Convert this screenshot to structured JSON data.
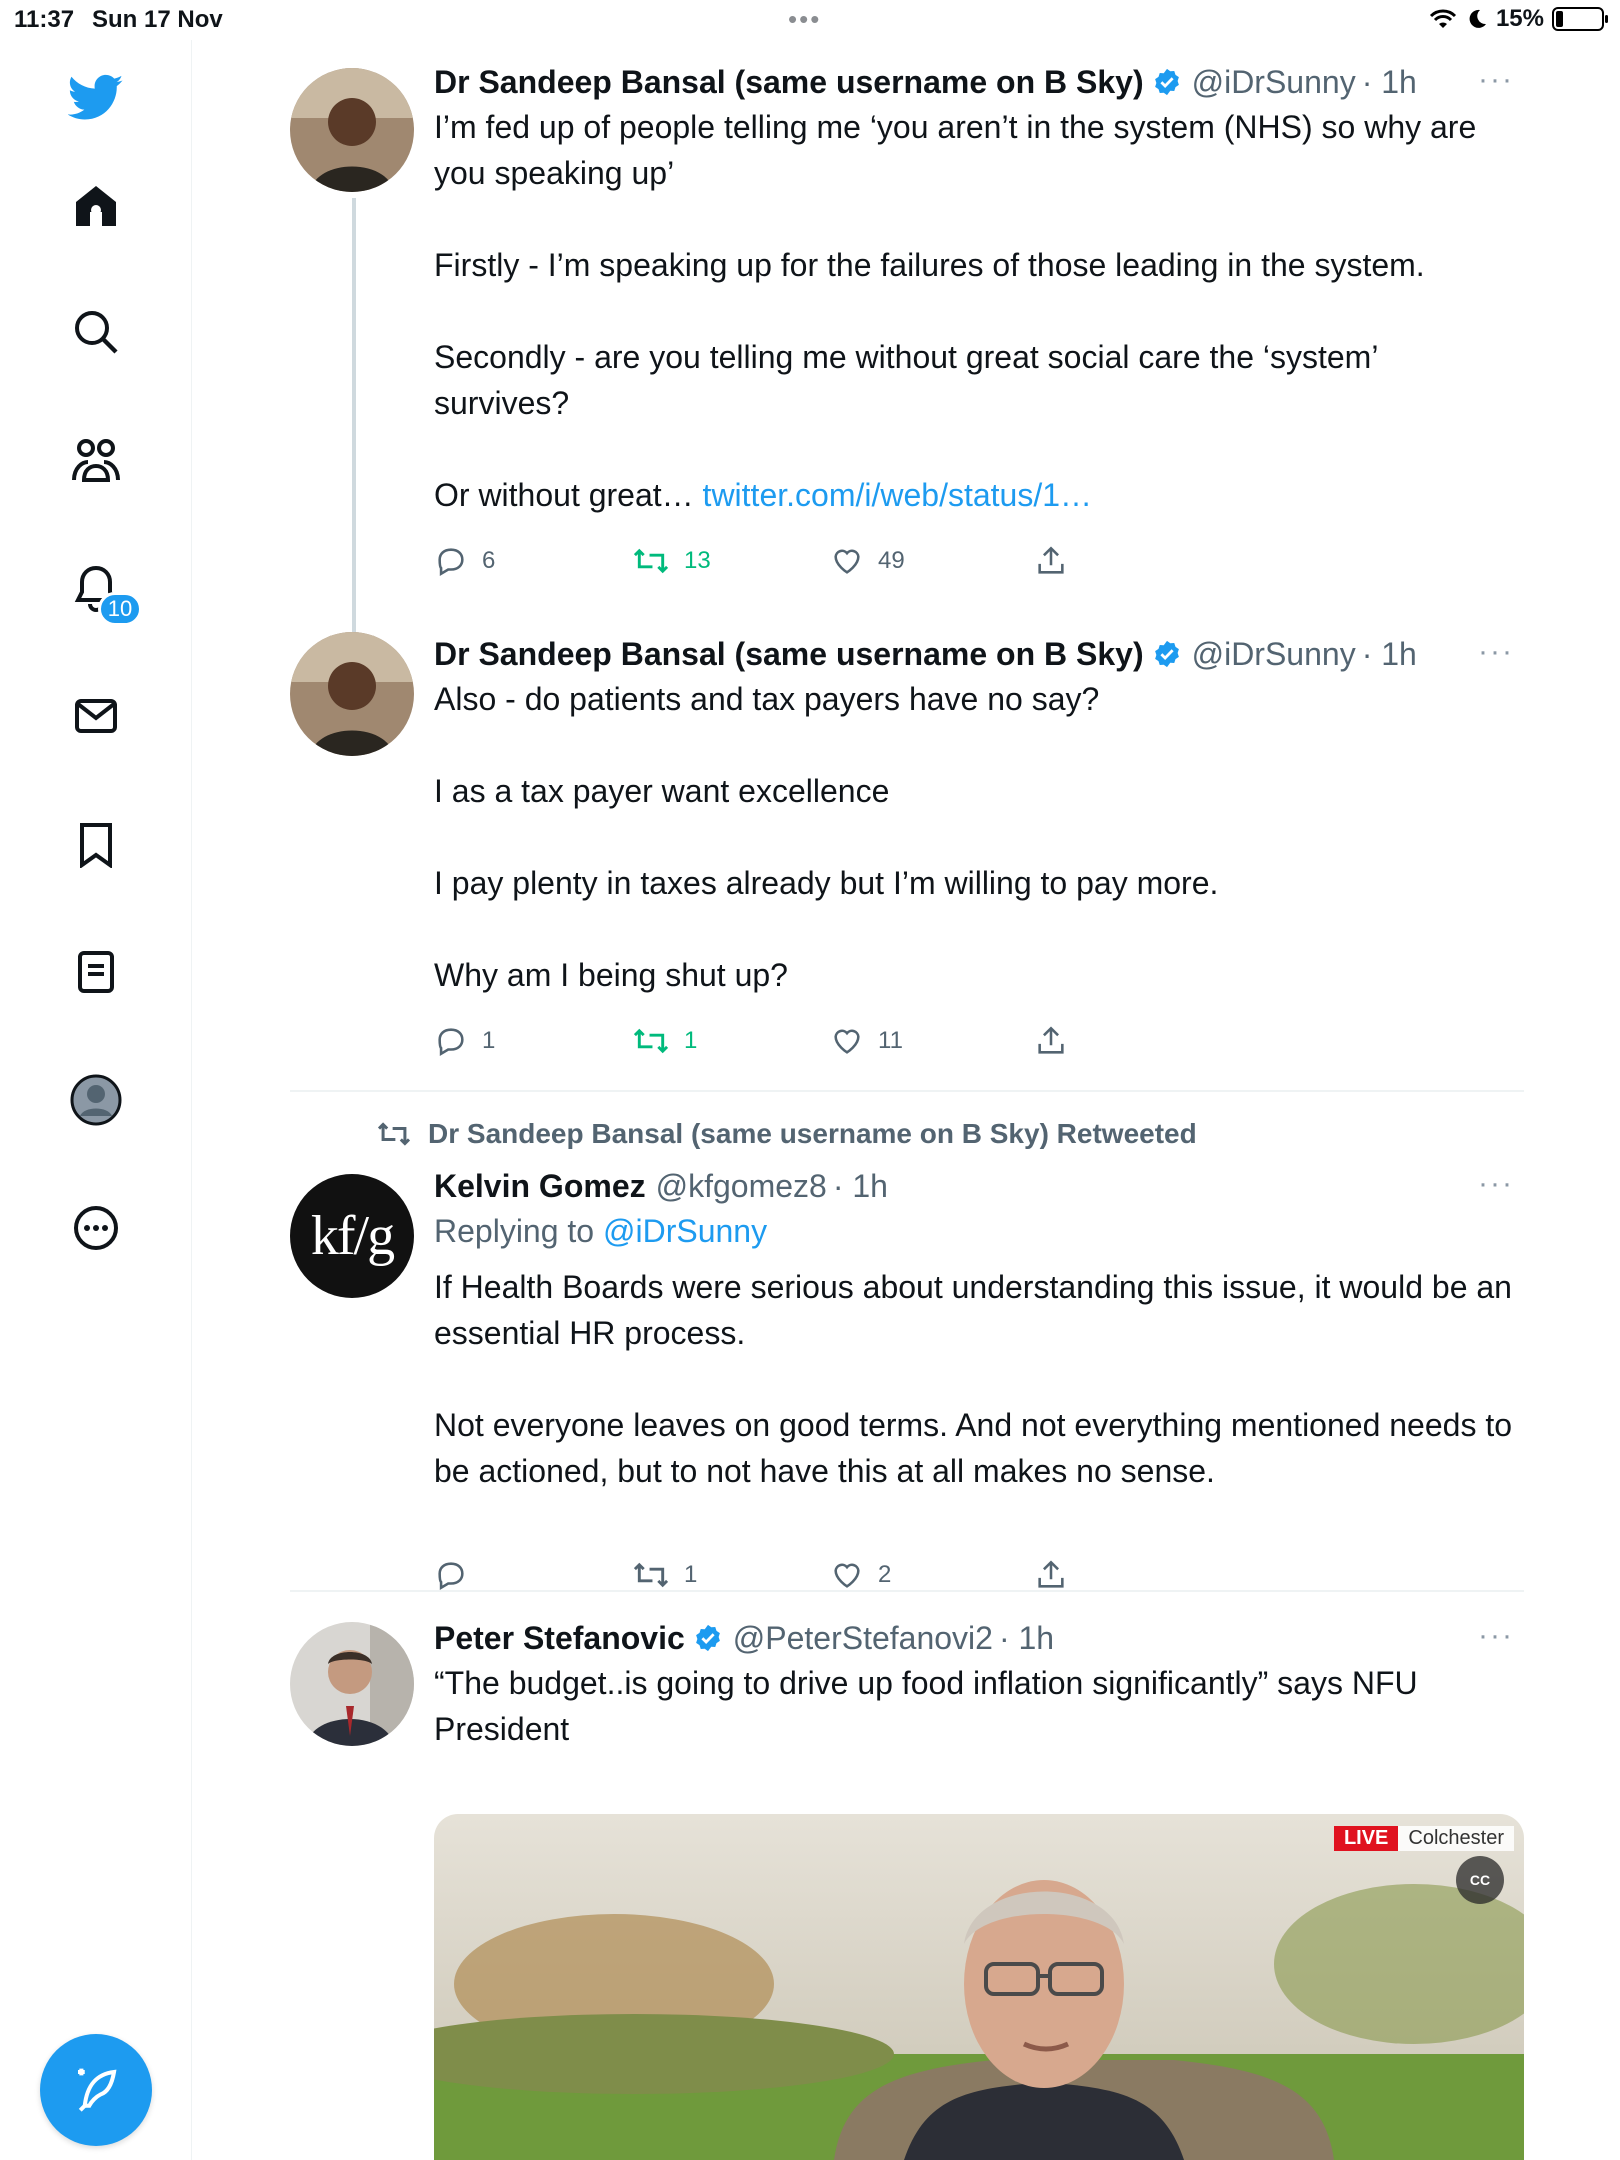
{
  "status_bar": {
    "time": "11:37",
    "date": "Sun 17 Nov",
    "battery_percent": "15%",
    "battery_level": 0.15
  },
  "sidebar": {
    "items": [
      {
        "icon": "twitter-logo-icon"
      },
      {
        "icon": "home-icon"
      },
      {
        "icon": "search-icon"
      },
      {
        "icon": "communities-icon"
      },
      {
        "icon": "notifications-icon"
      },
      {
        "icon": "messages-icon"
      },
      {
        "icon": "bookmarks-icon"
      },
      {
        "icon": "lists-icon"
      },
      {
        "icon": "profile-icon"
      },
      {
        "icon": "more-icon"
      }
    ],
    "notification_count": "10",
    "compose_icon": "compose-icon"
  },
  "colors": {
    "accent": "#1d9bf0",
    "retweet_green": "#00ba7c",
    "secondary_text": "#536471"
  },
  "tweets": [
    {
      "name": "Dr Sandeep Bansal (same username on B Sky)",
      "handle": "@iDrSunny",
      "time": "· 1h",
      "verified": true,
      "text": "I’m fed up of people telling me ‘you aren’t in the system (NHS) so why are you speaking up’\n\nFirstly - I’m speaking up for the failures of those leading in the system.\n\nSecondly - are you telling me without great social care the ‘system’ survives?\n\nOr without great… ",
      "link": "twitter.com/i/web/status/1…",
      "replies": "6",
      "retweets": "13",
      "likes": "49"
    },
    {
      "name": "Dr Sandeep Bansal (same username on B Sky)",
      "handle": "@iDrSunny",
      "time": "· 1h",
      "verified": true,
      "text": "Also - do patients and tax payers have no say?\n\nI as a tax payer want excellence\n\nI pay plenty in taxes already but I’m willing to pay more.\n\nWhy am I being shut up?",
      "replies": "1",
      "retweets": "1",
      "likes": "11"
    },
    {
      "retweeted_by": "Dr Sandeep Bansal (same username on B Sky) Retweeted",
      "name": "Kelvin Gomez",
      "handle": "@kfgomez8",
      "time": "· 1h",
      "avatar_text": "kf/g",
      "replying_label": "Replying to ",
      "replying_to": "@iDrSunny",
      "text": "If Health Boards were serious about understanding this issue, it would be an essential HR process.\n\nNot everyone leaves on good terms. And not everything mentioned needs to be actioned, but to not have this at all makes no sense.",
      "replies": "",
      "retweets": "1",
      "likes": "2"
    },
    {
      "name": "Peter Stefanovic",
      "handle": "@PeterStefanovi2",
      "time": "· 1h",
      "verified": true,
      "text": "“The budget..is going to drive up food inflation significantly” says NFU President",
      "media": {
        "live_label": "LIVE",
        "location": "Colchester",
        "cc_label": "CC"
      }
    }
  ]
}
